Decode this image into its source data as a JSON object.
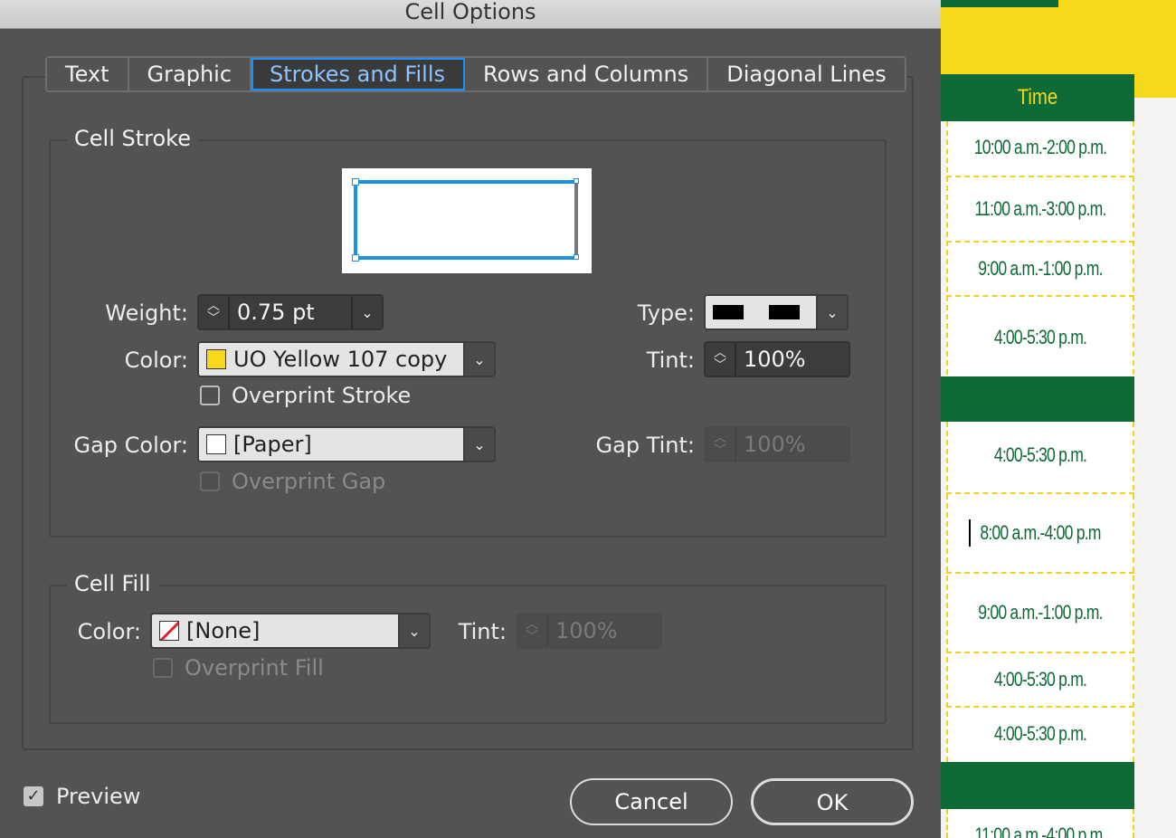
{
  "window": {
    "title": "Cell Options"
  },
  "tabs": [
    {
      "label": "Text",
      "active": false
    },
    {
      "label": "Graphic",
      "active": false
    },
    {
      "label": "Strokes and Fills",
      "active": true
    },
    {
      "label": "Rows and Columns",
      "active": false
    },
    {
      "label": "Diagonal Lines",
      "active": false
    }
  ],
  "cell_stroke": {
    "group_label": "Cell Stroke",
    "weight_label": "Weight:",
    "weight_value": "0.75 pt",
    "type_label": "Type:",
    "color_label": "Color:",
    "color_value": "UO Yellow 107 copy",
    "color_swatch": "#f6d91b",
    "tint_label": "Tint:",
    "tint_value": "100%",
    "overprint_stroke_label": "Overprint Stroke",
    "overprint_stroke_checked": false,
    "gap_color_label": "Gap Color:",
    "gap_color_value": "[Paper]",
    "gap_tint_label": "Gap Tint:",
    "gap_tint_value": "100%",
    "overprint_gap_label": "Overprint Gap",
    "overprint_gap_checked": false
  },
  "cell_fill": {
    "group_label": "Cell Fill",
    "color_label": "Color:",
    "color_value": "[None]",
    "tint_label": "Tint:",
    "tint_value": "100%",
    "overprint_fill_label": "Overprint Fill",
    "overprint_fill_checked": false
  },
  "footer": {
    "preview_label": "Preview",
    "preview_checked": true,
    "cancel_label": "Cancel",
    "ok_label": "OK"
  },
  "document": {
    "header": "Time",
    "rows": [
      "10:00 a.m.-2:00 p.m.",
      "11:00 a.m.-3:00 p.m.",
      "9:00 a.m.-1:00 p.m.",
      "4:00-5:30 p.m.",
      "4:00-5:30 p.m.",
      "8:00 a.m.-4:00 p.m",
      "9:00 a.m.-1:00 p.m.",
      "4:00-5:30 p.m.",
      "4:00-5:30 p.m.",
      "11:00 a.m.-4:00 p.m."
    ],
    "brand_green": "#0e6a36",
    "brand_yellow": "#f6d91b"
  }
}
